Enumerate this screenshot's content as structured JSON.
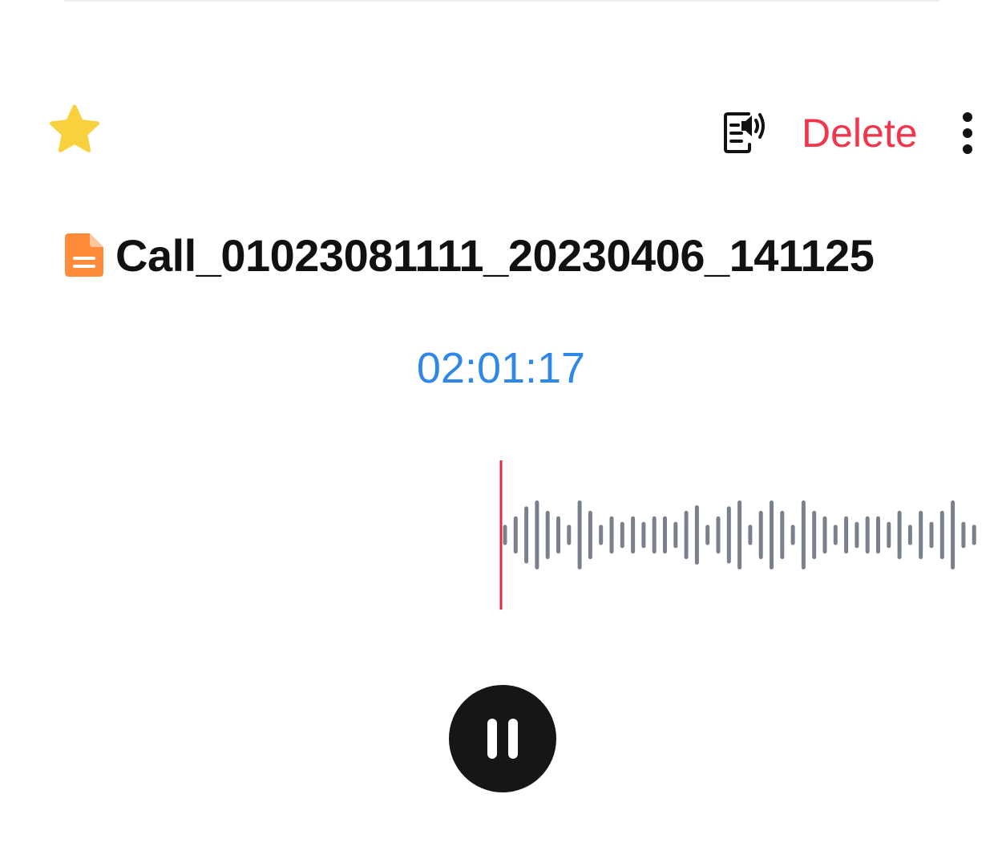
{
  "toolbar": {
    "favorite_icon": "star-icon",
    "favorite_color": "#f8d13f",
    "transcribe_icon": "speech-to-text-icon",
    "delete_label": "Delete",
    "delete_color": "#f2354a",
    "more_icon": "more-vertical-icon"
  },
  "recording": {
    "file_icon": "document-icon",
    "file_icon_color": "#ff8c3a",
    "title": "Call_01023081111_20230406_141125",
    "elapsed_time": "02:01:17",
    "time_color": "#2f88e8"
  },
  "waveform": {
    "playhead_color": "#e8283a",
    "bar_color": "#7a808c",
    "amplitudes": [
      0.22,
      0.45,
      0.72,
      0.88,
      0.6,
      0.45,
      0.22,
      0.88,
      0.6,
      0.22,
      0.45,
      0.3,
      0.45,
      0.3,
      0.45,
      0.45,
      0.3,
      0.6,
      0.75,
      0.22,
      0.45,
      0.72,
      0.88,
      0.22,
      0.6,
      0.88,
      0.6,
      0.22,
      0.88,
      0.6,
      0.45,
      0.22,
      0.45,
      0.3,
      0.45,
      0.45,
      0.3,
      0.6,
      0.22,
      0.6,
      0.3,
      0.6,
      0.88,
      0.3,
      0.22
    ]
  },
  "player": {
    "state_icon": "pause-icon"
  }
}
